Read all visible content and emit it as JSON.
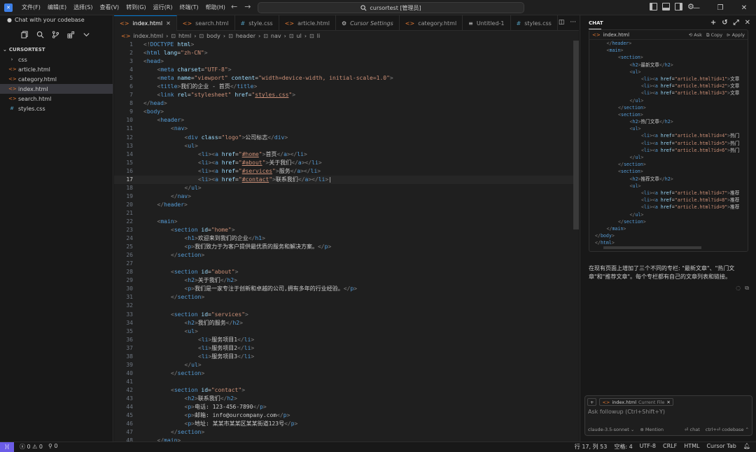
{
  "menu": [
    "文件(F)",
    "编辑(E)",
    "选择(S)",
    "查看(V)",
    "转到(G)",
    "运行(R)",
    "终端(T)",
    "帮助(H)"
  ],
  "search_text": "cursortest [管理员]",
  "sidebar": {
    "chat_label": "Chat with your codebase",
    "root": "CURSORTEST",
    "items": [
      {
        "name": "css",
        "kind": "folder"
      },
      {
        "name": "article.html",
        "kind": "html"
      },
      {
        "name": "category.html",
        "kind": "html"
      },
      {
        "name": "index.html",
        "kind": "html",
        "active": true
      },
      {
        "name": "search.html",
        "kind": "html"
      },
      {
        "name": "styles.css",
        "kind": "css"
      }
    ]
  },
  "tabs": [
    {
      "label": "index.html",
      "kind": "html",
      "active": true
    },
    {
      "label": "search.html",
      "kind": "html"
    },
    {
      "label": "style.css",
      "kind": "css"
    },
    {
      "label": "article.html",
      "kind": "html"
    },
    {
      "label": "Cursor Settings",
      "kind": "settings"
    },
    {
      "label": "category.html",
      "kind": "html"
    },
    {
      "label": "Untitled-1",
      "kind": "file"
    },
    {
      "label": "styles.css",
      "kind": "css"
    }
  ],
  "breadcrumb": [
    "index.html",
    "html",
    "body",
    "header",
    "nav",
    "ul",
    "li"
  ],
  "code": [
    {
      "n": 1,
      "i": 0,
      "h": "<span class=\"p\">&lt;!</span><span class=\"d\">DOCTYPE</span> <span class=\"a\">html</span><span class=\"p\">&gt;</span>"
    },
    {
      "n": 2,
      "i": 0,
      "h": "<span class=\"p\">&lt;</span><span class=\"t\">html</span> <span class=\"a\">lang</span>=<span class=\"s\">\"zh-CN\"</span><span class=\"p\">&gt;</span>"
    },
    {
      "n": 3,
      "i": 0,
      "h": "<span class=\"p\">&lt;</span><span class=\"t\">head</span><span class=\"p\">&gt;</span>"
    },
    {
      "n": 4,
      "i": 1,
      "h": "<span class=\"p\">&lt;</span><span class=\"t\">meta</span> <span class=\"a\">charset</span>=<span class=\"s\">\"UTF-8\"</span><span class=\"p\">&gt;</span>"
    },
    {
      "n": 5,
      "i": 1,
      "h": "<span class=\"p\">&lt;</span><span class=\"t\">meta</span> <span class=\"a\">name</span>=<span class=\"s\">\"viewport\"</span> <span class=\"a\">content</span>=<span class=\"s\">\"width=device-width, initial-scale=1.0\"</span><span class=\"p\">&gt;</span>"
    },
    {
      "n": 6,
      "i": 1,
      "h": "<span class=\"p\">&lt;</span><span class=\"t\">title</span><span class=\"p\">&gt;</span>我们的企业 - 首页<span class=\"p\">&lt;/</span><span class=\"t\">title</span><span class=\"p\">&gt;</span>"
    },
    {
      "n": 7,
      "i": 1,
      "h": "<span class=\"p\">&lt;</span><span class=\"t\">link</span> <span class=\"a\">rel</span>=<span class=\"s\">\"stylesheet\"</span> <span class=\"a\">href</span>=<span class=\"s\">\"<u>styles.css</u>\"</span><span class=\"p\">&gt;</span>"
    },
    {
      "n": 8,
      "i": 0,
      "h": "<span class=\"p\">&lt;/</span><span class=\"t\">head</span><span class=\"p\">&gt;</span>"
    },
    {
      "n": 9,
      "i": 0,
      "h": "<span class=\"p\">&lt;</span><span class=\"t\">body</span><span class=\"p\">&gt;</span>"
    },
    {
      "n": 10,
      "i": 1,
      "h": "<span class=\"p\">&lt;</span><span class=\"t\">header</span><span class=\"p\">&gt;</span>"
    },
    {
      "n": 11,
      "i": 2,
      "h": "<span class=\"p\">&lt;</span><span class=\"t\">nav</span><span class=\"p\">&gt;</span>"
    },
    {
      "n": 12,
      "i": 3,
      "h": "<span class=\"p\">&lt;</span><span class=\"t\">div</span> <span class=\"a\">class</span>=<span class=\"s\">\"logo\"</span><span class=\"p\">&gt;</span>公司标志<span class=\"p\">&lt;/</span><span class=\"t\">div</span><span class=\"p\">&gt;</span>"
    },
    {
      "n": 13,
      "i": 3,
      "h": "<span class=\"p\">&lt;</span><span class=\"t\">ul</span><span class=\"p\">&gt;</span>"
    },
    {
      "n": 14,
      "i": 4,
      "h": "<span class=\"p\">&lt;</span><span class=\"t\">li</span><span class=\"p\">&gt;&lt;</span><span class=\"t\">a</span> <span class=\"a\">href</span>=<span class=\"s\">\"<u>#home</u>\"</span><span class=\"p\">&gt;</span>首页<span class=\"p\">&lt;/</span><span class=\"t\">a</span><span class=\"p\">&gt;&lt;/</span><span class=\"t\">li</span><span class=\"p\">&gt;</span>"
    },
    {
      "n": 15,
      "i": 4,
      "h": "<span class=\"p\">&lt;</span><span class=\"t\">li</span><span class=\"p\">&gt;&lt;</span><span class=\"t\">a</span> <span class=\"a\">href</span>=<span class=\"s\">\"<u>#about</u>\"</span><span class=\"p\">&gt;</span>关于我们<span class=\"p\">&lt;/</span><span class=\"t\">a</span><span class=\"p\">&gt;&lt;/</span><span class=\"t\">li</span><span class=\"p\">&gt;</span>"
    },
    {
      "n": 16,
      "i": 4,
      "h": "<span class=\"p\">&lt;</span><span class=\"t\">li</span><span class=\"p\">&gt;&lt;</span><span class=\"t\">a</span> <span class=\"a\">href</span>=<span class=\"s\">\"<u>#services</u>\"</span><span class=\"p\">&gt;</span>服务<span class=\"p\">&lt;/</span><span class=\"t\">a</span><span class=\"p\">&gt;&lt;/</span><span class=\"t\">li</span><span class=\"p\">&gt;</span>"
    },
    {
      "n": 17,
      "i": 4,
      "h": "<span class=\"p\">&lt;</span><span class=\"t\">li</span><span class=\"p\">&gt;&lt;</span><span class=\"t\">a</span> <span class=\"a\">href</span>=<span class=\"s\">\"<u>#contact</u>\"</span><span class=\"p\">&gt;</span>联系我们<span class=\"p\">&lt;/</span><span class=\"t\">a</span><span class=\"p\">&gt;&lt;/</span><span class=\"t\">li</span><span class=\"p\">&gt;</span>|",
      "cur": true
    },
    {
      "n": 18,
      "i": 3,
      "h": "<span class=\"p\">&lt;/</span><span class=\"t\">ul</span><span class=\"p\">&gt;</span>"
    },
    {
      "n": 19,
      "i": 2,
      "h": "<span class=\"p\">&lt;/</span><span class=\"t\">nav</span><span class=\"p\">&gt;</span>"
    },
    {
      "n": 20,
      "i": 1,
      "h": "<span class=\"p\">&lt;/</span><span class=\"t\">header</span><span class=\"p\">&gt;</span>"
    },
    {
      "n": 21,
      "i": 0,
      "h": ""
    },
    {
      "n": 22,
      "i": 1,
      "h": "<span class=\"p\">&lt;</span><span class=\"t\">main</span><span class=\"p\">&gt;</span>"
    },
    {
      "n": 23,
      "i": 2,
      "h": "<span class=\"p\">&lt;</span><span class=\"t\">section</span> <span class=\"a\">id</span>=<span class=\"s\">\"home\"</span><span class=\"p\">&gt;</span>"
    },
    {
      "n": 24,
      "i": 3,
      "h": "<span class=\"p\">&lt;</span><span class=\"t\">h1</span><span class=\"p\">&gt;</span>欢迎来到我们的企业<span class=\"p\">&lt;/</span><span class=\"t\">h1</span><span class=\"p\">&gt;</span>"
    },
    {
      "n": 25,
      "i": 3,
      "h": "<span class=\"p\">&lt;</span><span class=\"t\">p</span><span class=\"p\">&gt;</span>我们致力于为客户提供最优质的服务和解决方案。<span class=\"p\">&lt;/</span><span class=\"t\">p</span><span class=\"p\">&gt;</span>"
    },
    {
      "n": 26,
      "i": 2,
      "h": "<span class=\"p\">&lt;/</span><span class=\"t\">section</span><span class=\"p\">&gt;</span>"
    },
    {
      "n": 27,
      "i": 0,
      "h": ""
    },
    {
      "n": 28,
      "i": 2,
      "h": "<span class=\"p\">&lt;</span><span class=\"t\">section</span> <span class=\"a\">id</span>=<span class=\"s\">\"about\"</span><span class=\"p\">&gt;</span>"
    },
    {
      "n": 29,
      "i": 3,
      "h": "<span class=\"p\">&lt;</span><span class=\"t\">h2</span><span class=\"p\">&gt;</span>关于我们<span class=\"p\">&lt;/</span><span class=\"t\">h2</span><span class=\"p\">&gt;</span>"
    },
    {
      "n": 30,
      "i": 3,
      "h": "<span class=\"p\">&lt;</span><span class=\"t\">p</span><span class=\"p\">&gt;</span>我们是一家专注于创新和卓越的公司,拥有多年的行业经验。<span class=\"p\">&lt;/</span><span class=\"t\">p</span><span class=\"p\">&gt;</span>"
    },
    {
      "n": 31,
      "i": 2,
      "h": "<span class=\"p\">&lt;/</span><span class=\"t\">section</span><span class=\"p\">&gt;</span>"
    },
    {
      "n": 32,
      "i": 0,
      "h": ""
    },
    {
      "n": 33,
      "i": 2,
      "h": "<span class=\"p\">&lt;</span><span class=\"t\">section</span> <span class=\"a\">id</span>=<span class=\"s\">\"services\"</span><span class=\"p\">&gt;</span>"
    },
    {
      "n": 34,
      "i": 3,
      "h": "<span class=\"p\">&lt;</span><span class=\"t\">h2</span><span class=\"p\">&gt;</span>我们的服务<span class=\"p\">&lt;/</span><span class=\"t\">h2</span><span class=\"p\">&gt;</span>"
    },
    {
      "n": 35,
      "i": 3,
      "h": "<span class=\"p\">&lt;</span><span class=\"t\">ul</span><span class=\"p\">&gt;</span>"
    },
    {
      "n": 36,
      "i": 4,
      "h": "<span class=\"p\">&lt;</span><span class=\"t\">li</span><span class=\"p\">&gt;</span>服务项目1<span class=\"p\">&lt;/</span><span class=\"t\">li</span><span class=\"p\">&gt;</span>"
    },
    {
      "n": 37,
      "i": 4,
      "h": "<span class=\"p\">&lt;</span><span class=\"t\">li</span><span class=\"p\">&gt;</span>服务项目2<span class=\"p\">&lt;/</span><span class=\"t\">li</span><span class=\"p\">&gt;</span>"
    },
    {
      "n": 38,
      "i": 4,
      "h": "<span class=\"p\">&lt;</span><span class=\"t\">li</span><span class=\"p\">&gt;</span>服务项目3<span class=\"p\">&lt;/</span><span class=\"t\">li</span><span class=\"p\">&gt;</span>"
    },
    {
      "n": 39,
      "i": 3,
      "h": "<span class=\"p\">&lt;/</span><span class=\"t\">ul</span><span class=\"p\">&gt;</span>"
    },
    {
      "n": 40,
      "i": 2,
      "h": "<span class=\"p\">&lt;/</span><span class=\"t\">section</span><span class=\"p\">&gt;</span>"
    },
    {
      "n": 41,
      "i": 0,
      "h": ""
    },
    {
      "n": 42,
      "i": 2,
      "h": "<span class=\"p\">&lt;</span><span class=\"t\">section</span> <span class=\"a\">id</span>=<span class=\"s\">\"contact\"</span><span class=\"p\">&gt;</span>"
    },
    {
      "n": 43,
      "i": 3,
      "h": "<span class=\"p\">&lt;</span><span class=\"t\">h2</span><span class=\"p\">&gt;</span>联系我们<span class=\"p\">&lt;/</span><span class=\"t\">h2</span><span class=\"p\">&gt;</span>"
    },
    {
      "n": 44,
      "i": 3,
      "h": "<span class=\"p\">&lt;</span><span class=\"t\">p</span><span class=\"p\">&gt;</span>电话: 123-456-7890<span class=\"p\">&lt;/</span><span class=\"t\">p</span><span class=\"p\">&gt;</span>"
    },
    {
      "n": 45,
      "i": 3,
      "h": "<span class=\"p\">&lt;</span><span class=\"t\">p</span><span class=\"p\">&gt;</span>邮箱: info@ourcompany.com<span class=\"p\">&lt;/</span><span class=\"t\">p</span><span class=\"p\">&gt;</span>"
    },
    {
      "n": 46,
      "i": 3,
      "h": "<span class=\"p\">&lt;</span><span class=\"t\">p</span><span class=\"p\">&gt;</span>地址: 某某市某某区某某街道123号<span class=\"p\">&lt;/</span><span class=\"t\">p</span><span class=\"p\">&gt;</span>"
    },
    {
      "n": 47,
      "i": 2,
      "h": "<span class=\"p\">&lt;/</span><span class=\"t\">section</span><span class=\"p\">&gt;</span>"
    },
    {
      "n": 48,
      "i": 1,
      "h": "<span class=\"p\">&lt;/</span><span class=\"t\">main</span><span class=\"p\">&gt;</span>"
    }
  ],
  "chat": {
    "title": "CHAT",
    "card_file": "index.html",
    "card_actions": [
      "Ask",
      "Copy",
      "Apply"
    ],
    "card_code": [
      {
        "i": 1,
        "h": "<span class=\"p\">&lt;/</span><span class=\"t\">header</span><span class=\"p\">&gt;</span>"
      },
      {
        "i": 1,
        "h": "<span class=\"p\">&lt;</span><span class=\"t\">main</span><span class=\"p\">&gt;</span>"
      },
      {
        "i": 2,
        "h": "<span class=\"p\">&lt;</span><span class=\"t\">section</span><span class=\"p\">&gt;</span>"
      },
      {
        "i": 3,
        "h": "<span class=\"p\">&lt;</span><span class=\"t\">h2</span><span class=\"p\">&gt;</span>最新文章<span class=\"p\">&lt;/</span><span class=\"t\">h2</span><span class=\"p\">&gt;</span>"
      },
      {
        "i": 3,
        "h": "<span class=\"p\">&lt;</span><span class=\"t\">ul</span><span class=\"p\">&gt;</span>"
      },
      {
        "i": 4,
        "h": "<span class=\"p\">&lt;</span><span class=\"t\">li</span><span class=\"p\">&gt;&lt;</span><span class=\"t\">a</span> <span class=\"a\">href</span>=<span class=\"s\">\"article.html?id=1\"</span><span class=\"p\">&gt;</span>文章"
      },
      {
        "i": 4,
        "h": "<span class=\"p\">&lt;</span><span class=\"t\">li</span><span class=\"p\">&gt;&lt;</span><span class=\"t\">a</span> <span class=\"a\">href</span>=<span class=\"s\">\"article.html?id=2\"</span><span class=\"p\">&gt;</span>文章"
      },
      {
        "i": 4,
        "h": "<span class=\"p\">&lt;</span><span class=\"t\">li</span><span class=\"p\">&gt;&lt;</span><span class=\"t\">a</span> <span class=\"a\">href</span>=<span class=\"s\">\"article.html?id=3\"</span><span class=\"p\">&gt;</span>文章"
      },
      {
        "i": 3,
        "h": "<span class=\"p\">&lt;/</span><span class=\"t\">ul</span><span class=\"p\">&gt;</span>"
      },
      {
        "i": 2,
        "h": "<span class=\"p\">&lt;/</span><span class=\"t\">section</span><span class=\"p\">&gt;</span>"
      },
      {
        "i": 2,
        "h": "<span class=\"p\">&lt;</span><span class=\"t\">section</span><span class=\"p\">&gt;</span>"
      },
      {
        "i": 3,
        "h": "<span class=\"p\">&lt;</span><span class=\"t\">h2</span><span class=\"p\">&gt;</span>热门文章<span class=\"p\">&lt;/</span><span class=\"t\">h2</span><span class=\"p\">&gt;</span>"
      },
      {
        "i": 3,
        "h": "<span class=\"p\">&lt;</span><span class=\"t\">ul</span><span class=\"p\">&gt;</span>"
      },
      {
        "i": 4,
        "h": "<span class=\"p\">&lt;</span><span class=\"t\">li</span><span class=\"p\">&gt;&lt;</span><span class=\"t\">a</span> <span class=\"a\">href</span>=<span class=\"s\">\"article.html?id=4\"</span><span class=\"p\">&gt;</span>热门"
      },
      {
        "i": 4,
        "h": "<span class=\"p\">&lt;</span><span class=\"t\">li</span><span class=\"p\">&gt;&lt;</span><span class=\"t\">a</span> <span class=\"a\">href</span>=<span class=\"s\">\"article.html?id=5\"</span><span class=\"p\">&gt;</span>热门"
      },
      {
        "i": 4,
        "h": "<span class=\"p\">&lt;</span><span class=\"t\">li</span><span class=\"p\">&gt;&lt;</span><span class=\"t\">a</span> <span class=\"a\">href</span>=<span class=\"s\">\"article.html?id=6\"</span><span class=\"p\">&gt;</span>热门"
      },
      {
        "i": 3,
        "h": "<span class=\"p\">&lt;/</span><span class=\"t\">ul</span><span class=\"p\">&gt;</span>"
      },
      {
        "i": 2,
        "h": "<span class=\"p\">&lt;/</span><span class=\"t\">section</span><span class=\"p\">&gt;</span>"
      },
      {
        "i": 2,
        "h": "<span class=\"p\">&lt;</span><span class=\"t\">section</span><span class=\"p\">&gt;</span>"
      },
      {
        "i": 3,
        "h": "<span class=\"p\">&lt;</span><span class=\"t\">h2</span><span class=\"p\">&gt;</span>推荐文章<span class=\"p\">&lt;/</span><span class=\"t\">h2</span><span class=\"p\">&gt;</span>"
      },
      {
        "i": 3,
        "h": "<span class=\"p\">&lt;</span><span class=\"t\">ul</span><span class=\"p\">&gt;</span>"
      },
      {
        "i": 4,
        "h": "<span class=\"p\">&lt;</span><span class=\"t\">li</span><span class=\"p\">&gt;&lt;</span><span class=\"t\">a</span> <span class=\"a\">href</span>=<span class=\"s\">\"article.html?id=7\"</span><span class=\"p\">&gt;</span>推荐"
      },
      {
        "i": 4,
        "h": "<span class=\"p\">&lt;</span><span class=\"t\">li</span><span class=\"p\">&gt;&lt;</span><span class=\"t\">a</span> <span class=\"a\">href</span>=<span class=\"s\">\"article.html?id=8\"</span><span class=\"p\">&gt;</span>推荐"
      },
      {
        "i": 4,
        "h": "<span class=\"p\">&lt;</span><span class=\"t\">li</span><span class=\"p\">&gt;&lt;</span><span class=\"t\">a</span> <span class=\"a\">href</span>=<span class=\"s\">\"article.html?id=9\"</span><span class=\"p\">&gt;</span>推荐"
      },
      {
        "i": 3,
        "h": "<span class=\"p\">&lt;/</span><span class=\"t\">ul</span><span class=\"p\">&gt;</span>"
      },
      {
        "i": 2,
        "h": "<span class=\"p\">&lt;/</span><span class=\"t\">section</span><span class=\"p\">&gt;</span>"
      },
      {
        "i": 1,
        "h": "<span class=\"p\">&lt;/</span><span class=\"t\">main</span><span class=\"p\">&gt;</span>"
      },
      {
        "i": 0,
        "h": "<span class=\"p\">&lt;/</span><span class=\"t\">body</span><span class=\"p\">&gt;</span>"
      },
      {
        "i": 0,
        "h": "<span class=\"p\">&lt;/</span><span class=\"t\">html</span><span class=\"p\">&gt;</span>"
      }
    ],
    "reply": "在现有页面上增加了三个不同的专栏: \"最新文章\"、\"热门文章\"和\"推荐文章\"。每个专栏都有自己的文章列表和链接。",
    "context_file": "index.html",
    "context_tag": "Current File",
    "followup_placeholder": "Ask followup (Ctrl+Shift+Y)",
    "model": "claude-3.5-sonnet",
    "mention": "Mention",
    "chat_btn": "chat",
    "codebase_btn": "ctrl+⏎ codebase"
  },
  "status": {
    "errors": "0",
    "warnings": "0",
    "ports": "0",
    "position": "行 17, 列 53",
    "spaces": "空格: 4",
    "encoding": "UTF-8",
    "eol": "CRLF",
    "language": "HTML",
    "tab": "Cursor Tab"
  }
}
